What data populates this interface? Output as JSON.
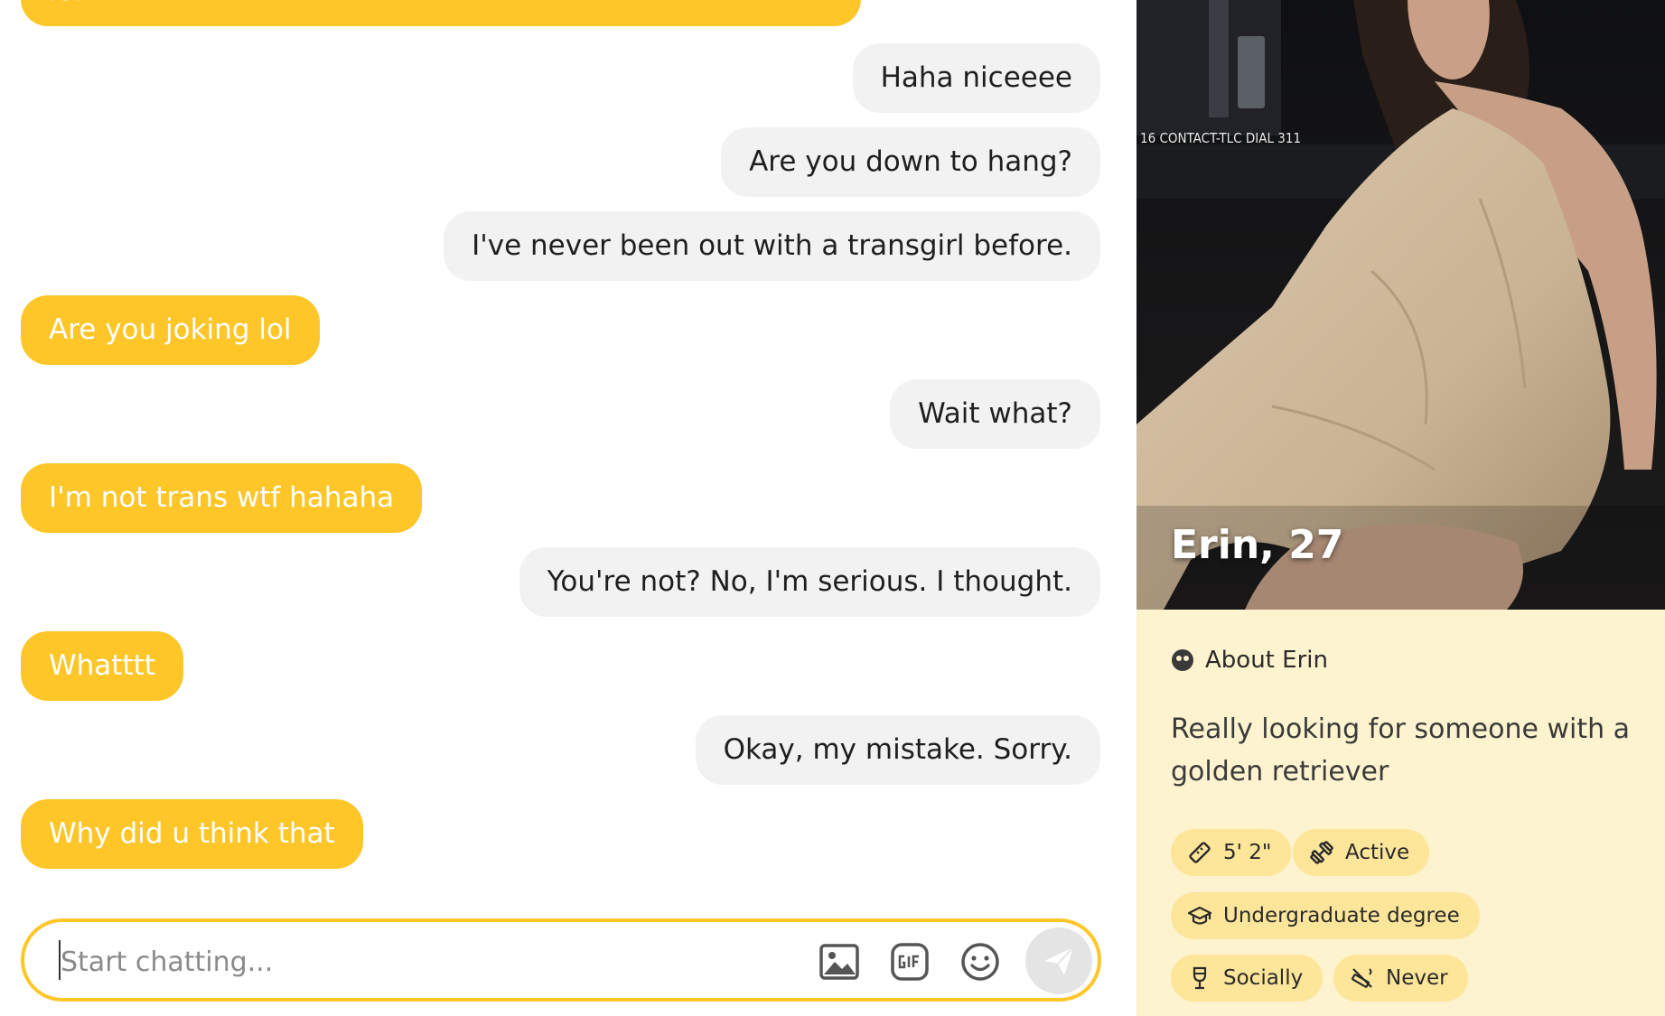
{
  "conversation": {
    "partial_top_message": "lol",
    "messages": [
      {
        "from": "me",
        "text": "Haha niceeee"
      },
      {
        "from": "me",
        "text": "Are you down to hang?"
      },
      {
        "from": "me",
        "text": "I've never been out with a transgirl before."
      },
      {
        "from": "them",
        "text": "Are you joking lol"
      },
      {
        "from": "me",
        "text": "Wait what?"
      },
      {
        "from": "them",
        "text": "I'm not trans wtf hahaha"
      },
      {
        "from": "me",
        "text": "You're not? No, I'm serious. I thought."
      },
      {
        "from": "them",
        "text": "Whatttt"
      },
      {
        "from": "me",
        "text": "Okay, my mistake. Sorry."
      },
      {
        "from": "them",
        "text": "Why did u think that"
      }
    ]
  },
  "composer": {
    "placeholder": "Start chatting...",
    "icons": [
      "image-icon",
      "gif-icon",
      "emoji-icon",
      "send-icon"
    ]
  },
  "profile": {
    "name_age": "Erin, 27",
    "photo_sign_text": "16 CONTACT-TLC DIAL 311",
    "about_title": "About Erin",
    "bio": "Really looking for someone with a golden retriever",
    "chips": [
      {
        "icon": "ruler-icon",
        "label": "5' 2\""
      },
      {
        "icon": "dumbbell-icon",
        "label": "Active"
      },
      {
        "icon": "graduation-cap-icon",
        "label": "Undergraduate degree"
      },
      {
        "icon": "wine-glass-icon",
        "label": "Socially"
      },
      {
        "icon": "no-smoking-icon",
        "label": "Never"
      }
    ]
  },
  "colors": {
    "accent": "#ffc629",
    "sent_bubble": "#f2f2f2",
    "profile_bg": "#fef3cf",
    "chip_bg": "#fde59a"
  }
}
